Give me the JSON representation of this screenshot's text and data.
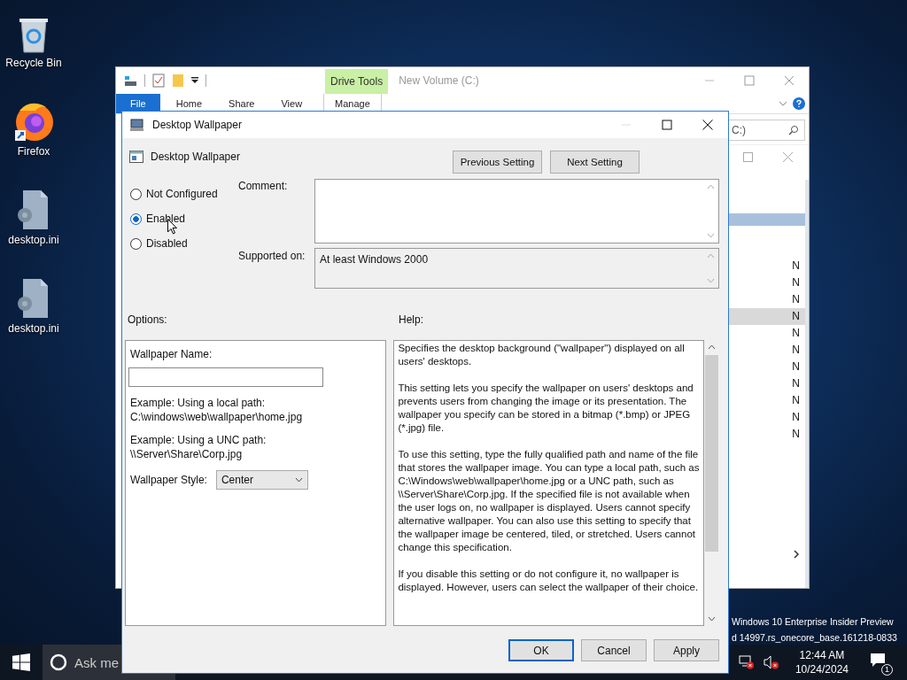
{
  "desktop": {
    "icons": [
      {
        "label": "Recycle Bin",
        "kind": "recycle-bin"
      },
      {
        "label": "Firefox",
        "kind": "browser"
      },
      {
        "label": "desktop.ini",
        "kind": "settings-file"
      },
      {
        "label": "desktop.ini",
        "kind": "settings-file"
      }
    ],
    "build_info": [
      "Windows 10 Enterprise Insider Preview",
      "d 14997.rs_onecore_base.161218-0833"
    ]
  },
  "explorer": {
    "title": "New Volume (C:)",
    "context_tab": "Drive Tools",
    "ribbon_tabs": [
      {
        "label": "File",
        "kind": "file"
      },
      {
        "label": "Home",
        "kind": "tab"
      },
      {
        "label": "Share",
        "kind": "tab"
      },
      {
        "label": "View",
        "kind": "tab"
      },
      {
        "label": "Manage",
        "kind": "context"
      }
    ],
    "address": "C:)",
    "list_rows": [
      {
        "column_2": "N",
        "selected": false
      },
      {
        "column_2": "N",
        "selected": false
      },
      {
        "column_2": "N",
        "selected": false
      },
      {
        "column_2": "N",
        "selected": true
      },
      {
        "column_2": "N",
        "selected": false
      },
      {
        "column_2": "N",
        "selected": false
      },
      {
        "column_2": "N",
        "selected": false
      },
      {
        "column_2": "N",
        "selected": false
      },
      {
        "column_2": "N",
        "selected": false
      },
      {
        "column_2": "N",
        "selected": false
      },
      {
        "column_2": "N",
        "selected": false
      }
    ]
  },
  "dialog": {
    "title": "Desktop Wallpaper",
    "setting_name": "Desktop Wallpaper",
    "nav_buttons": [
      "Previous Setting",
      "Next Setting"
    ],
    "states": [
      {
        "label": "Not Configured",
        "selected": false
      },
      {
        "label": "Enabled",
        "selected": true
      },
      {
        "label": "Disabled",
        "selected": false
      }
    ],
    "comment": {
      "label": "Comment:"
    },
    "supported_on": {
      "label": "Supported on:",
      "value": "At least Windows 2000"
    },
    "options_label": "Options:",
    "help_label": "Help:",
    "options": {
      "name_label": "Wallpaper Name:",
      "examples": [
        [
          "Example: Using a local path:",
          "C:\\windows\\web\\wallpaper\\home.jpg"
        ],
        [
          "Example: Using a UNC path:",
          "\\\\Server\\Share\\Corp.jpg"
        ]
      ],
      "style_label": "Wallpaper Style:",
      "style_value": "Center"
    },
    "help": [
      "Specifies the desktop background (\"wallpaper\") displayed on all users' desktops.",
      "This setting lets you specify the wallpaper on users' desktops and prevents users from changing the image or its presentation. The wallpaper you specify can be stored in a bitmap (*.bmp) or JPEG (*.jpg) file.",
      "To use this setting, type the fully qualified path and name of the file that stores the wallpaper image. You can type a local path, such as C:\\Windows\\web\\wallpaper\\home.jpg or a UNC path, such as \\\\Server\\Share\\Corp.jpg. If the specified file is not available when the user logs on, no wallpaper is displayed. Users cannot specify alternative wallpaper. You can also use this setting to specify that the wallpaper image be centered, tiled, or stretched. Users cannot change this specification.",
      "If you disable this setting or do not configure it, no wallpaper is displayed. However, users can select the wallpaper of their choice."
    ],
    "buttons": [
      {
        "label": "OK",
        "default": true
      },
      {
        "label": "Cancel",
        "default": false
      },
      {
        "label": "Apply",
        "default": false
      }
    ]
  },
  "taskbar": {
    "search_placeholder": "Ask me",
    "time": "12:44 AM",
    "date": "10/24/2024",
    "notification_count": "1"
  }
}
